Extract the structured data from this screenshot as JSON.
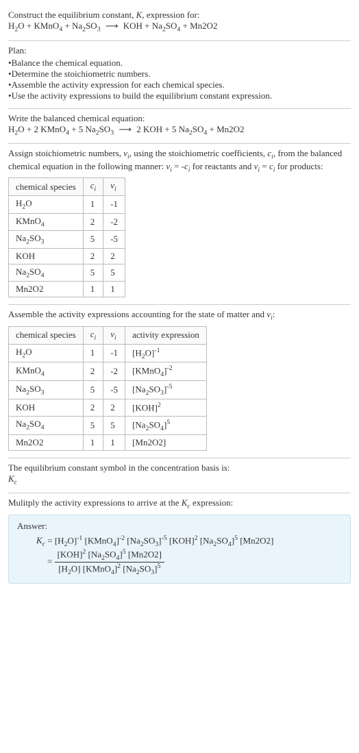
{
  "s1": {
    "intro": "Construct the equilibrium constant, K, expression for:",
    "equation_lhs": "H₂O + KMnO₄ + Na₂SO₃",
    "equation_rhs": "KOH + Na₂SO₄ + Mn2O2"
  },
  "s2": {
    "heading": "Plan:",
    "b1": "Balance the chemical equation.",
    "b2": "Determine the stoichiometric numbers.",
    "b3": "Assemble the activity expression for each chemical species.",
    "b4": "Use the activity expressions to build the equilibrium constant expression."
  },
  "s3": {
    "heading": "Write the balanced chemical equation:",
    "equation_lhs": "H₂O + 2 KMnO₄ + 5 Na₂SO₃",
    "equation_rhs": "2 KOH + 5 Na₂SO₄ + Mn2O2"
  },
  "s4": {
    "text_a": "Assign stoichiometric numbers, νᵢ, using the stoichiometric coefficients, cᵢ, from the balanced chemical equation in the following manner: νᵢ = -cᵢ for reactants and νᵢ = cᵢ for products:",
    "headers": {
      "h1": "chemical species",
      "h2": "cᵢ",
      "h3": "νᵢ"
    },
    "rows": [
      {
        "s": "H₂O",
        "c": "1",
        "v": "-1"
      },
      {
        "s": "KMnO₄",
        "c": "2",
        "v": "-2"
      },
      {
        "s": "Na₂SO₃",
        "c": "5",
        "v": "-5"
      },
      {
        "s": "KOH",
        "c": "2",
        "v": "2"
      },
      {
        "s": "Na₂SO₄",
        "c": "5",
        "v": "5"
      },
      {
        "s": "Mn2O2",
        "c": "1",
        "v": "1"
      }
    ]
  },
  "s5": {
    "text": "Assemble the activity expressions accounting for the state of matter and νᵢ:",
    "headers": {
      "h1": "chemical species",
      "h2": "cᵢ",
      "h3": "νᵢ",
      "h4": "activity expression"
    },
    "rows": [
      {
        "s": "H₂O",
        "c": "1",
        "v": "-1",
        "a": "[H₂O]⁻¹"
      },
      {
        "s": "KMnO₄",
        "c": "2",
        "v": "-2",
        "a": "[KMnO₄]⁻²"
      },
      {
        "s": "Na₂SO₃",
        "c": "5",
        "v": "-5",
        "a": "[Na₂SO₃]⁻⁵"
      },
      {
        "s": "KOH",
        "c": "2",
        "v": "2",
        "a": "[KOH]²"
      },
      {
        "s": "Na₂SO₄",
        "c": "5",
        "v": "5",
        "a": "[Na₂SO₄]⁵"
      },
      {
        "s": "Mn2O2",
        "c": "1",
        "v": "1",
        "a": "[Mn2O2]"
      }
    ]
  },
  "s6": {
    "l1": "The equilibrium constant symbol in the concentration basis is:",
    "l2": "K_c"
  },
  "s7": {
    "text": "Mulitply the activity expressions to arrive at the K_c expression:"
  },
  "s8": {
    "answer_label": "Answer:",
    "line1": "K_c = [H₂O]⁻¹ [KMnO₄]⁻² [Na₂SO₃]⁻⁵ [KOH]² [Na₂SO₄]⁵ [Mn2O2]",
    "frac_num": "[KOH]² [Na₂SO₄]⁵ [Mn2O2]",
    "frac_den": "[H₂O] [KMnO₄]² [Na₂SO₃]⁵"
  }
}
